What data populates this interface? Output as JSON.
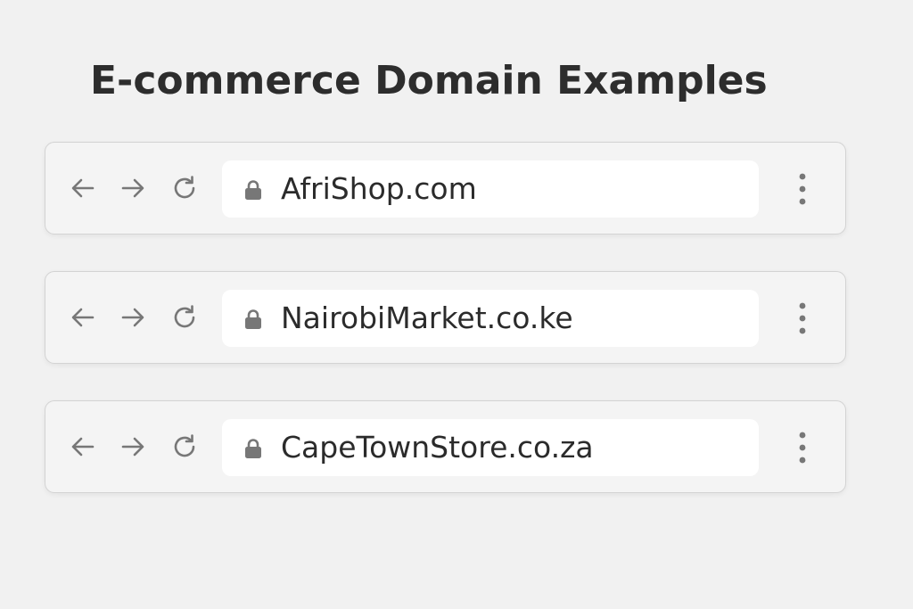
{
  "page": {
    "title": "E-commerce Domain Examples"
  },
  "bars": [
    {
      "url": "AfriShop.com"
    },
    {
      "url": "NairobiMarket.co.ke"
    },
    {
      "url": "CapeTownStore.co.za"
    }
  ],
  "icons": {
    "back": "arrow-left-icon",
    "forward": "arrow-right-icon",
    "reload": "reload-icon",
    "lock": "lock-icon",
    "menu": "more-vertical-icon"
  },
  "colors": {
    "background": "#f1f1f1",
    "bar_background": "#f4f4f4",
    "bar_border": "#d3d3d3",
    "address_background": "#ffffff",
    "icon": "#777777",
    "text": "#2b2b2b"
  }
}
